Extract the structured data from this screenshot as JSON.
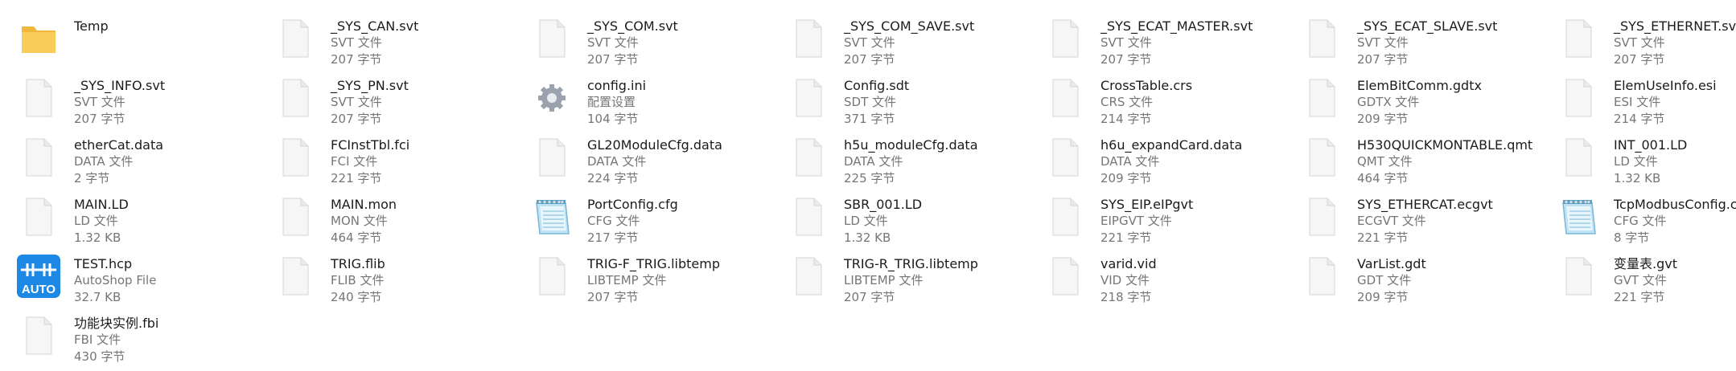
{
  "files": [
    {
      "name": "Temp",
      "type": "",
      "size": "",
      "icon": "folder-icon"
    },
    {
      "name": "_SYS_CAN.svt",
      "type": "SVT 文件",
      "size": "207 字节",
      "icon": "file-icon"
    },
    {
      "name": "_SYS_COM.svt",
      "type": "SVT 文件",
      "size": "207 字节",
      "icon": "file-icon"
    },
    {
      "name": "_SYS_COM_SAVE.svt",
      "type": "SVT 文件",
      "size": "207 字节",
      "icon": "file-icon"
    },
    {
      "name": "_SYS_ECAT_MASTER.svt",
      "type": "SVT 文件",
      "size": "207 字节",
      "icon": "file-icon"
    },
    {
      "name": "_SYS_ECAT_SLAVE.svt",
      "type": "SVT 文件",
      "size": "207 字节",
      "icon": "file-icon"
    },
    {
      "name": "_SYS_ETHERNET.svt",
      "type": "SVT 文件",
      "size": "207 字节",
      "icon": "file-icon"
    },
    {
      "name": "_SYS_INFO.svt",
      "type": "SVT 文件",
      "size": "207 字节",
      "icon": "file-icon"
    },
    {
      "name": "_SYS_PN.svt",
      "type": "SVT 文件",
      "size": "207 字节",
      "icon": "file-icon"
    },
    {
      "name": "config.ini",
      "type": "配置设置",
      "size": "104 字节",
      "icon": "gear-file-icon"
    },
    {
      "name": "Config.sdt",
      "type": "SDT 文件",
      "size": "371 字节",
      "icon": "file-icon"
    },
    {
      "name": "CrossTable.crs",
      "type": "CRS 文件",
      "size": "214 字节",
      "icon": "file-icon"
    },
    {
      "name": "ElemBitComm.gdtx",
      "type": "GDTX 文件",
      "size": "209 字节",
      "icon": "file-icon"
    },
    {
      "name": "ElemUseInfo.esi",
      "type": "ESI 文件",
      "size": "214 字节",
      "icon": "file-icon"
    },
    {
      "name": "etherCat.data",
      "type": "DATA 文件",
      "size": "2 字节",
      "icon": "file-icon"
    },
    {
      "name": "FCInstTbl.fci",
      "type": "FCI 文件",
      "size": "221 字节",
      "icon": "file-icon"
    },
    {
      "name": "GL20ModuleCfg.data",
      "type": "DATA 文件",
      "size": "224 字节",
      "icon": "file-icon"
    },
    {
      "name": "h5u_moduleCfg.data",
      "type": "DATA 文件",
      "size": "225 字节",
      "icon": "file-icon"
    },
    {
      "name": "h6u_expandCard.data",
      "type": "DATA 文件",
      "size": "209 字节",
      "icon": "file-icon"
    },
    {
      "name": "H530QUICKMONTABLE.qmt",
      "type": "QMT 文件",
      "size": "464 字节",
      "icon": "file-icon"
    },
    {
      "name": "INT_001.LD",
      "type": "LD 文件",
      "size": "1.32 KB",
      "icon": "file-icon"
    },
    {
      "name": "MAIN.LD",
      "type": "LD 文件",
      "size": "1.32 KB",
      "icon": "file-icon"
    },
    {
      "name": "MAIN.mon",
      "type": "MON 文件",
      "size": "464 字节",
      "icon": "file-icon"
    },
    {
      "name": "PortConfig.cfg",
      "type": "CFG 文件",
      "size": "217 字节",
      "icon": "notepad-icon"
    },
    {
      "name": "SBR_001.LD",
      "type": "LD 文件",
      "size": "1.32 KB",
      "icon": "file-icon"
    },
    {
      "name": "SYS_EIP.eIPgvt",
      "type": "EIPGVT 文件",
      "size": "221 字节",
      "icon": "file-icon"
    },
    {
      "name": "SYS_ETHERCAT.ecgvt",
      "type": "ECGVT 文件",
      "size": "221 字节",
      "icon": "file-icon"
    },
    {
      "name": "TcpModbusConfig.cfg",
      "type": "CFG 文件",
      "size": "8 字节",
      "icon": "notepad-icon"
    },
    {
      "name": "TEST.hcp",
      "type": "AutoShop File",
      "size": "32.7 KB",
      "icon": "autoshop-icon"
    },
    {
      "name": "TRIG.flib",
      "type": "FLIB 文件",
      "size": "240 字节",
      "icon": "file-icon"
    },
    {
      "name": "TRIG-F_TRIG.libtemp",
      "type": "LIBTEMP 文件",
      "size": "207 字节",
      "icon": "file-icon"
    },
    {
      "name": "TRIG-R_TRIG.libtemp",
      "type": "LIBTEMP 文件",
      "size": "207 字节",
      "icon": "file-icon"
    },
    {
      "name": "varid.vid",
      "type": "VID 文件",
      "size": "218 字节",
      "icon": "file-icon"
    },
    {
      "name": "VarList.gdt",
      "type": "GDT 文件",
      "size": "209 字节",
      "icon": "file-icon"
    },
    {
      "name": "变量表.gvt",
      "type": "GVT 文件",
      "size": "221 字节",
      "icon": "file-icon"
    },
    {
      "name": "功能块实例.fbi",
      "type": "FBI 文件",
      "size": "430 字节",
      "icon": "file-icon"
    }
  ],
  "autoshop_badge": "AUTO",
  "colors": {
    "folder": "#f5c04a",
    "autoshop": "#1e88e5",
    "text": "#1b1b1b",
    "subtext": "#767676"
  }
}
